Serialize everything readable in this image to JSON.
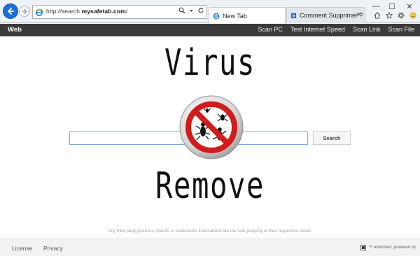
{
  "browser": {
    "address_url_prefix": "http://search.",
    "address_url_domain": "mysafetab.com",
    "address_url_suffix": "/",
    "tabs": [
      {
        "label": "New Tab",
        "active": true
      },
      {
        "label": "Comment Supprimer ? Net..."
      }
    ],
    "window_controls": {
      "minimize": "—",
      "maximize": "☐",
      "close": "✕"
    },
    "icons": [
      "back-arrow-icon",
      "forward-arrow-icon",
      "ie-logo-icon",
      "search-icon",
      "dropdown-icon",
      "refresh-icon",
      "home-icon",
      "favorites-star-icon",
      "settings-gear-icon",
      "smiley-feedback-icon"
    ]
  },
  "topbar": {
    "brand": "Web",
    "links": [
      "Scan PC",
      "Test Internet Speed",
      "Scan Link",
      "Scan File"
    ]
  },
  "main": {
    "headline_top": "Virus",
    "headline_bottom": "Remove",
    "search_button": "Search",
    "search_value": "",
    "badge": "no-bugs-icon",
    "disclaimer": "Any third party products, brands or trademarks listed above are the sole property of their respective owner."
  },
  "footer": {
    "license": "License",
    "privacy": "Privacy",
    "extension_text": "™ extension, powered by"
  },
  "colors": {
    "topbar_bg": "#3a3a3a",
    "back_button": "#1c6fd6",
    "prohibition_red": "#d21b1b",
    "input_border": "#7fa8d6"
  }
}
